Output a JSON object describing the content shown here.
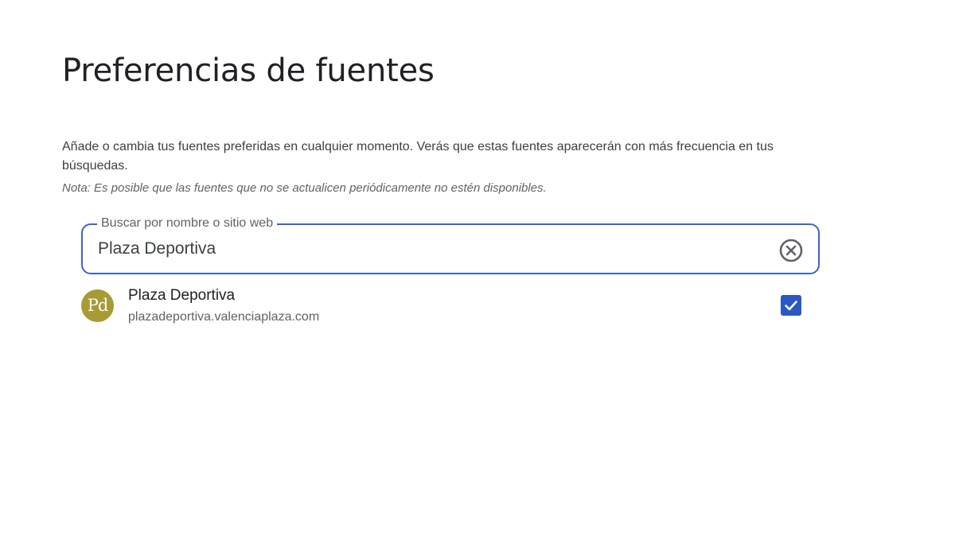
{
  "page": {
    "title": "Preferencias de fuentes",
    "description": "Añade o cambia tus fuentes preferidas en cualquier momento. Verás que estas fuentes aparecerán con más frecuencia en tus búsquedas.",
    "note": "Nota: Es posible que las fuentes que no se actualicen periódicamente no estén disponibles."
  },
  "search": {
    "label": "Buscar por nombre o sitio web",
    "value": "Plaza Deportiva",
    "clear_icon": "clear-circle-icon"
  },
  "results": [
    {
      "avatar_text": "Pd",
      "name": "Plaza Deportiva",
      "url": "plazadeportiva.valenciaplaza.com",
      "checked": true
    }
  ],
  "colors": {
    "accent": "#3b63c8",
    "checkbox": "#2a58c4",
    "avatar_bg": "#a89a35"
  }
}
